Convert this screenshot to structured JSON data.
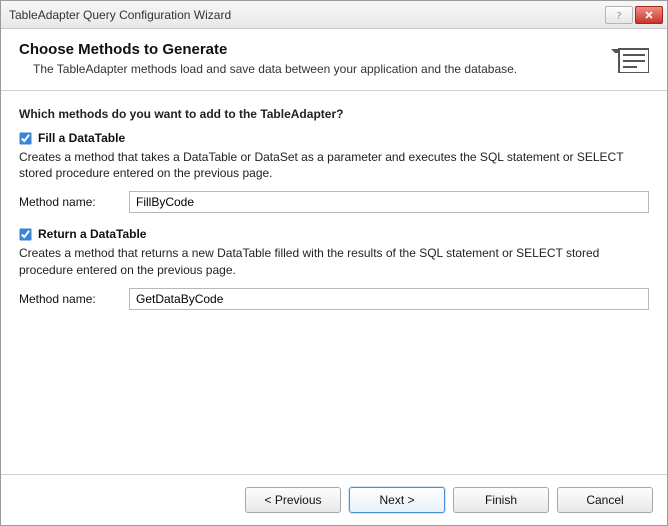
{
  "titlebar": {
    "title": "TableAdapter Query Configuration Wizard"
  },
  "header": {
    "title": "Choose Methods to Generate",
    "subtitle": "The TableAdapter methods load and save data between your application and the database."
  },
  "body": {
    "prompt": "Which methods do you want to add to the TableAdapter?",
    "fill": {
      "checked": true,
      "label": "Fill a DataTable",
      "desc": "Creates a method that takes a DataTable or DataSet as a parameter and executes the SQL statement or SELECT stored procedure entered on the previous page.",
      "method_label": "Method name:",
      "method_value": "FillByCode"
    },
    "return": {
      "checked": true,
      "label": "Return a DataTable",
      "desc": "Creates a method that returns a new DataTable filled with the results of the SQL statement or SELECT stored procedure entered on the previous page.",
      "method_label": "Method name:",
      "method_value": "GetDataByCode"
    }
  },
  "footer": {
    "previous": "< Previous",
    "next": "Next >",
    "finish": "Finish",
    "cancel": "Cancel"
  }
}
